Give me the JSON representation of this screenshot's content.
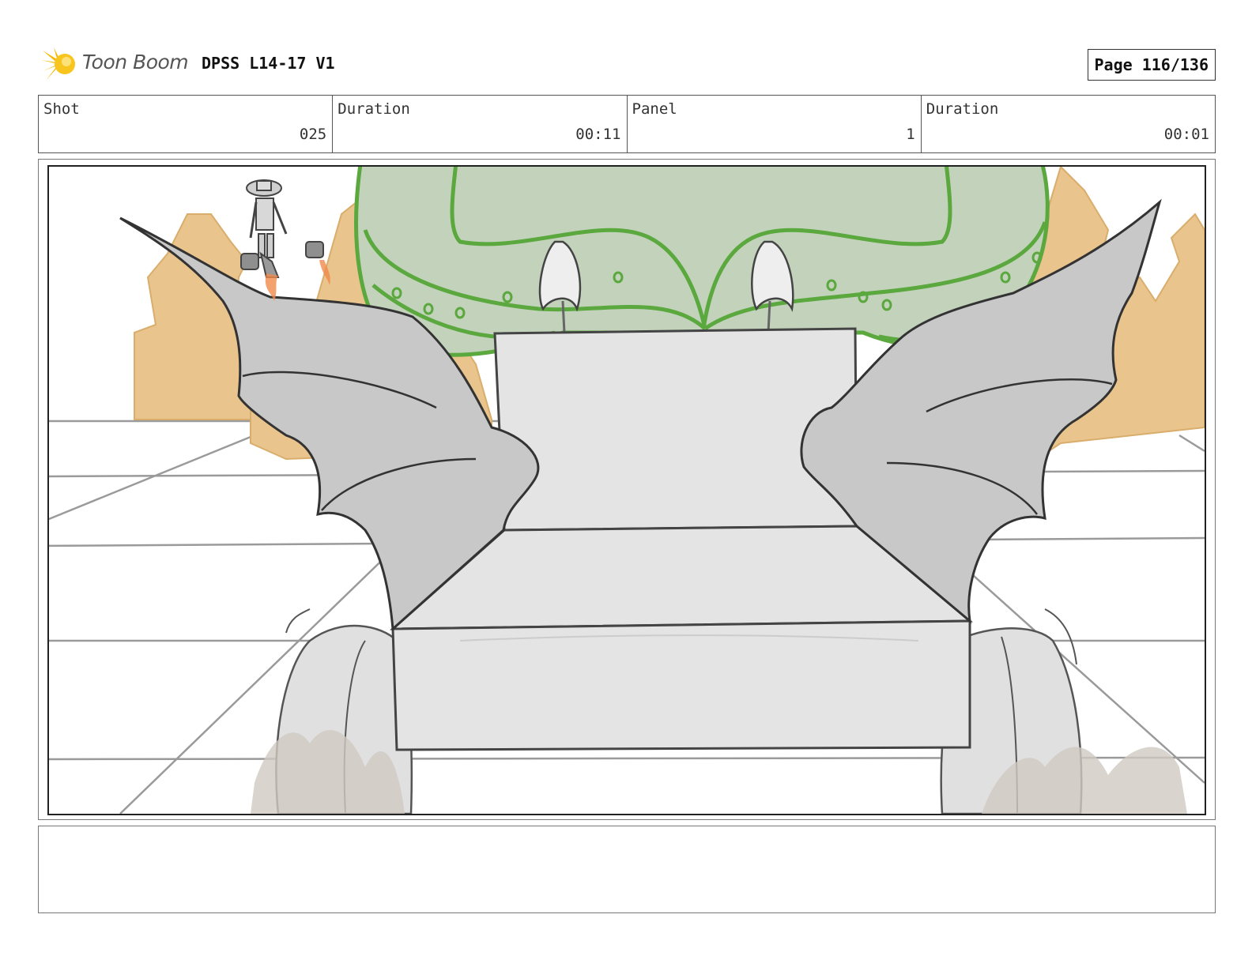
{
  "header": {
    "logo_text": "Toon Boom",
    "doc_title": "DPSS L14-17 V1",
    "page_label": "Page 116/136"
  },
  "info": [
    {
      "label": "Shot",
      "value": "025"
    },
    {
      "label": "Duration",
      "value": "00:11"
    },
    {
      "label": "Panel",
      "value": "1"
    },
    {
      "label": "Duration",
      "value": "00:01"
    }
  ],
  "colors": {
    "sky_green": "#c3d3bb",
    "outline_green": "#5aa83e",
    "castle_tan": "#e9c48c",
    "wing_gray": "#c8c8c8",
    "machine_gray": "#e4e4e4"
  },
  "notes": ""
}
